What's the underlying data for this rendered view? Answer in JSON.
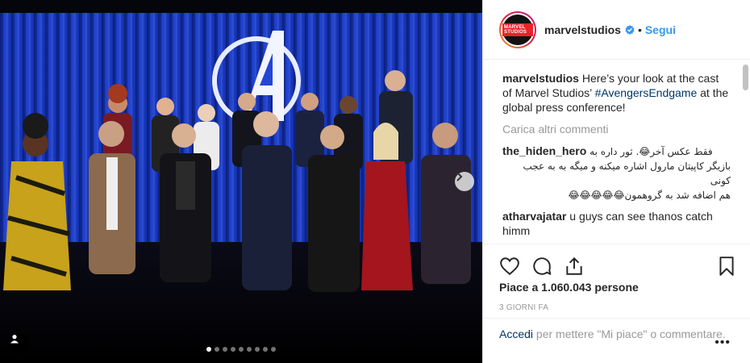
{
  "post": {
    "username": "marvelstudios",
    "logo_text": "MARVEL STUDIOS",
    "separator": "•",
    "follow_label": "Segui",
    "caption_user": "marvelstudios",
    "caption_text_1": "Here’s your look at the cast of Marvel Studios’",
    "caption_hashtag": "#AvengersEndgame",
    "caption_text_2": "at the global press conference!",
    "load_more_label": "Carica altri commenti",
    "comments": [
      {
        "user": "the_hiden_hero",
        "line1": "فقط عکس آخر😂. ثور داره به",
        "line2": "بازیگر کاپیتان مارول اشاره میکنه و میگه به به عجب کونی",
        "line3": "هم اضافه شد به گروهمون😂😂😂😂😂"
      },
      {
        "user": "atharvajatar",
        "text": "u guys can see thanos catch himm"
      }
    ],
    "likes_text": "Piace a 1.060.043 persone",
    "time_text": "3 giorni fa",
    "login_link": "Accedi",
    "login_text": "per mettere \"Mi piace\" o commentare.",
    "more_label": "•••"
  },
  "carousel": {
    "count": 9,
    "active_index": 0
  },
  "colors": {
    "accent": "#3897f0",
    "link": "#003569",
    "muted": "#999999",
    "backdrop": "#1d3fc4"
  }
}
